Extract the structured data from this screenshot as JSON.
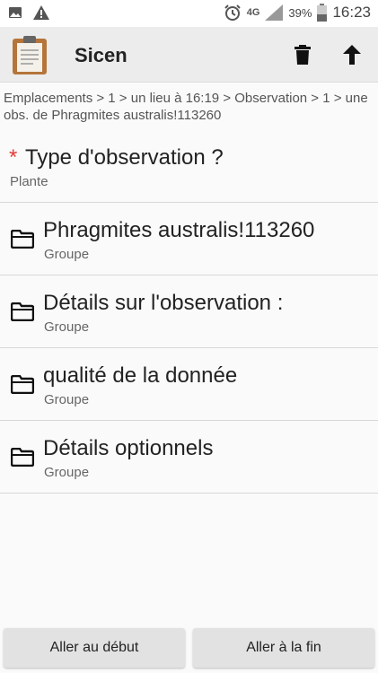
{
  "status_bar": {
    "battery_percent": "39%",
    "time": "16:23",
    "network": "4G",
    "icons": [
      "image-icon",
      "warning-icon",
      "alarm-icon",
      "signal-icon",
      "battery-icon"
    ]
  },
  "app_bar": {
    "title": "Sicen",
    "actions": [
      "delete-icon",
      "arrow-up-icon"
    ]
  },
  "breadcrumb": "Emplacements > 1 > un lieu à 16:19 > Observation > 1 > une obs. de Phragmites australis!113260",
  "question": {
    "required_marker": "*",
    "label": "Type d'observation ?",
    "value": "Plante"
  },
  "groups": [
    {
      "title": "Phragmites australis!113260",
      "subtitle": "Groupe"
    },
    {
      "title": "Détails sur l'observation :",
      "subtitle": "Groupe"
    },
    {
      "title": "qualité de la donnée",
      "subtitle": "Groupe"
    },
    {
      "title": "Détails optionnels",
      "subtitle": "Groupe"
    }
  ],
  "buttons": {
    "go_start": "Aller au début",
    "go_end": "Aller à la fin"
  },
  "colors": {
    "required": "#e53935",
    "app_bar": "#ececec",
    "background": "#fafafa"
  }
}
